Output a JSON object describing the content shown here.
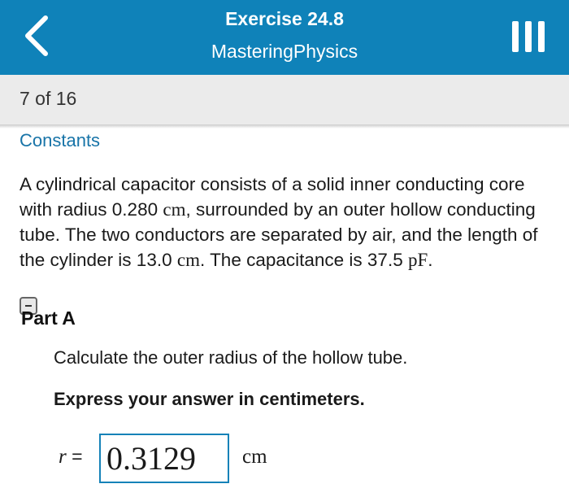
{
  "header": {
    "title": "Exercise 24.8",
    "subtitle": "MasteringPhysics",
    "bg_color": "#0f82b9",
    "back_icon": "chevron-left-icon",
    "menu_icon": "hamburger-menu-icon"
  },
  "pager": {
    "text": "7 of 16"
  },
  "constants_link": "Constants",
  "problem": {
    "seg1": "A cylindrical capacitor consists of a solid inner conducting core with radius 0.280 ",
    "unit1": "cm",
    "seg2": ", surrounded by an outer hollow conducting tube. The two conductors are separated by air, and the length of the cylinder is 13.0 ",
    "unit2": "cm",
    "seg3": ". The capacitance is 37.5 ",
    "unit3": "pF",
    "seg4": "."
  },
  "part": {
    "title": "Part A",
    "question": "Calculate the outer radius of the hollow tube.",
    "instruction": "Express your answer in centimeters."
  },
  "answer": {
    "variable": "r",
    "equals": " =",
    "value": "0.3129",
    "unit": "cm"
  }
}
